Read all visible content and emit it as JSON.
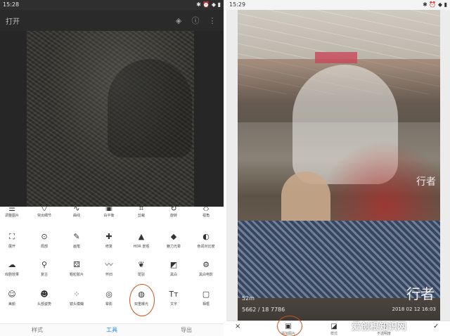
{
  "left": {
    "status": {
      "time": "15:28",
      "icons": "✱ ⏰ ◆ ▮"
    },
    "topbar": {
      "title": "打开",
      "icons": [
        "layers-icon",
        "info-icon",
        "more-icon"
      ]
    },
    "tools_row0": [
      "调整图片",
      "突出细节",
      "曲线",
      "白平衡",
      "剪裁",
      "旋转",
      "视角"
    ],
    "tools_row1": [
      "展开",
      "局部",
      "画笔",
      "修复",
      "HDR 景观",
      "魅力光晕",
      "色调对比度"
    ],
    "tools_row2": [
      "戏剧效果",
      "复古",
      "粗粒胶片",
      "怀旧",
      "斑驳",
      "黑白",
      "黑白电影"
    ],
    "tools_row3": [
      "美颜",
      "头部姿势",
      "镜头模糊",
      "晕影",
      "双重曝光",
      "文字",
      "相框"
    ],
    "tabs": [
      "样式",
      "工具",
      "导出"
    ],
    "active_tab": "工具"
  },
  "right": {
    "status": {
      "time": "15:29",
      "icons": "✱ ⏰ ◆ ▮"
    },
    "watermark": "行者",
    "vertical_text": "行者",
    "photo_meta1": "52m",
    "photo_meta2": "5662 / 18 7786",
    "photo_meta3": "2018 02 12 16:03",
    "bottombar": {
      "cancel": "×",
      "add_image": "添加图片",
      "style": "样式",
      "opacity": "不透明度",
      "confirm": "✓"
    }
  },
  "site_watermark": "爱创根知识网",
  "colors": {
    "accent": "#1e88e5",
    "marker": "#c8541e"
  }
}
